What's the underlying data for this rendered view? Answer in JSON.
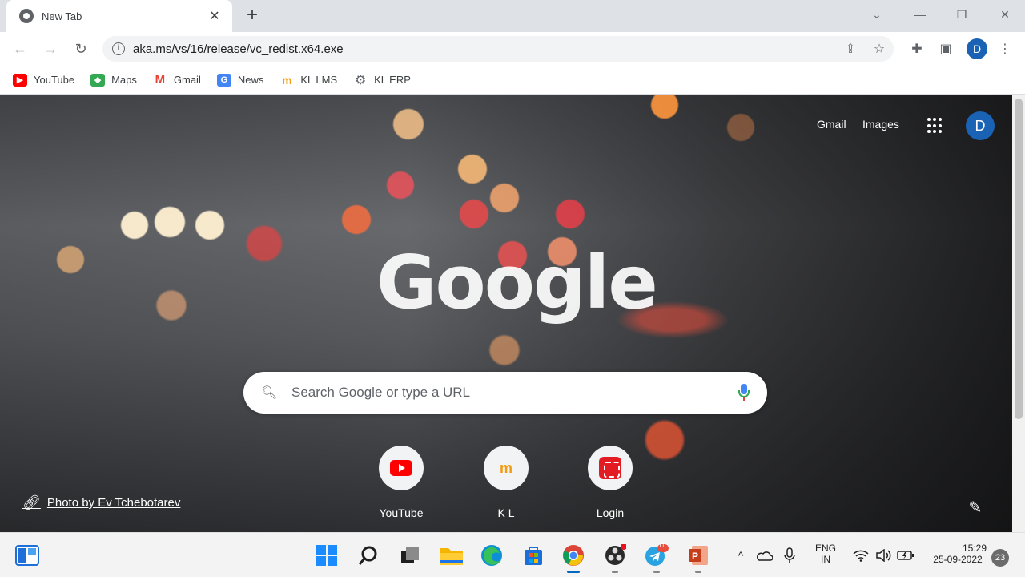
{
  "browser": {
    "tab": {
      "title": "New Tab",
      "close_glyph": "✕"
    },
    "new_tab_glyph": "+",
    "window_controls": [
      "⌄",
      "—",
      "❐",
      "✕"
    ],
    "nav": {
      "back": "←",
      "forward": "→",
      "reload": "↻"
    },
    "address_bar": {
      "url": "aka.ms/vs/16/release/vc_redist.x64.exe"
    },
    "profile_initial": "D",
    "bookmarks": [
      {
        "label": "YouTube",
        "icon": "youtube-icon"
      },
      {
        "label": "Maps",
        "icon": "maps-icon"
      },
      {
        "label": "Gmail",
        "icon": "gmail-icon"
      },
      {
        "label": "News",
        "icon": "news-icon"
      },
      {
        "label": "KL LMS",
        "icon": "moodle-icon"
      },
      {
        "label": "KL ERP",
        "icon": "gear-icon"
      }
    ]
  },
  "ntp": {
    "top_links": {
      "gmail": "Gmail",
      "images": "Images"
    },
    "avatar_initial": "D",
    "logo": "Google",
    "search_placeholder": "Search Google or type a URL",
    "shortcuts": [
      {
        "label": "YouTube",
        "icon": "youtube-icon"
      },
      {
        "label": "K L",
        "icon": "moodle-icon",
        "glyph": "m"
      },
      {
        "label": "Login",
        "icon": "login-icon"
      }
    ],
    "photo_credit": "Photo by Ev Tchebotarev"
  },
  "taskbar": {
    "language": {
      "line1": "ENG",
      "line2": "IN"
    },
    "time": "15:29",
    "date": "25-09-2022",
    "notification_count": "23",
    "telegram_badge": "11"
  },
  "colors": {
    "accent_blue": "#1a62b3",
    "youtube_red": "#ff0000"
  }
}
